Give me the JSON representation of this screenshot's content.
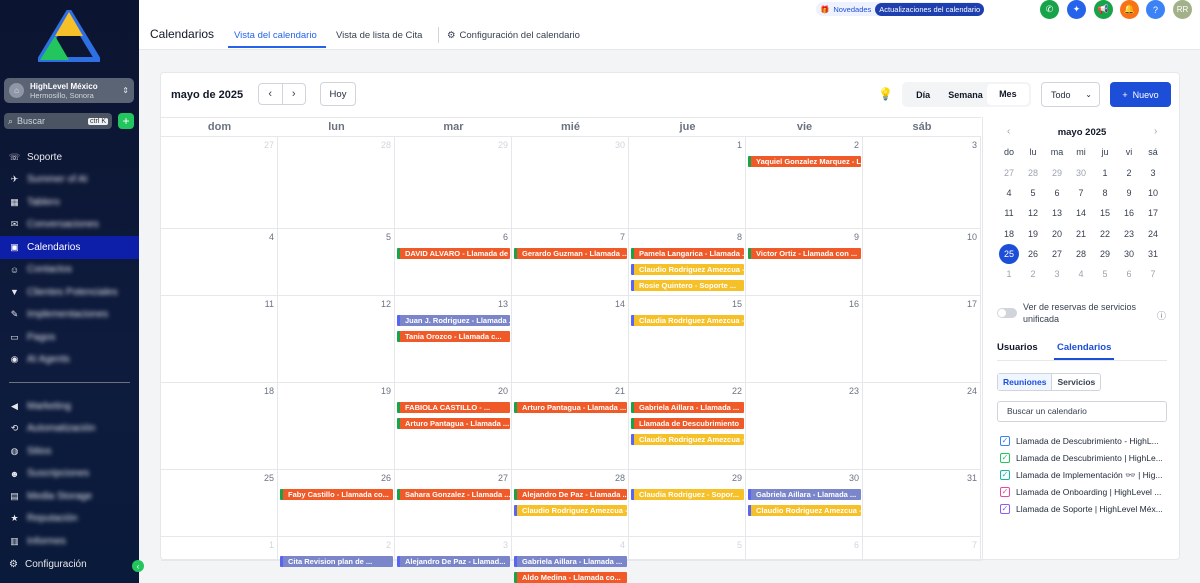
{
  "sidebar": {
    "account_name": "HighLevel México",
    "account_location": "Hermosillo, Sonora",
    "search_placeholder": "Buscar",
    "search_shortcut": "ctrl K",
    "items": [
      {
        "label": "Soporte",
        "icon": "phone-icon",
        "blur": false,
        "active": false
      },
      {
        "label": "Summer of AI",
        "icon": "rocket-icon",
        "blur": true,
        "active": false
      },
      {
        "label": "Tablero",
        "icon": "dashboard-icon",
        "blur": true,
        "active": false
      },
      {
        "label": "Conversaciones",
        "icon": "chat-icon",
        "blur": true,
        "active": false
      },
      {
        "label": "Calendarios",
        "icon": "calendar-icon",
        "blur": false,
        "active": true
      },
      {
        "label": "Contactos",
        "icon": "contacts-icon",
        "blur": true,
        "active": false
      },
      {
        "label": "Clientes Potenciales",
        "icon": "funnel-icon",
        "blur": true,
        "active": false
      },
      {
        "label": "Implementaciones",
        "icon": "tools-icon",
        "blur": true,
        "active": false
      },
      {
        "label": "Pagos",
        "icon": "card-icon",
        "blur": true,
        "active": false
      },
      {
        "label": "AI Agents",
        "icon": "robot-icon",
        "blur": true,
        "active": false
      },
      {
        "label": "Marketing",
        "icon": "megaphone-icon",
        "blur": true,
        "active": false
      },
      {
        "label": "Automatización",
        "icon": "automation-icon",
        "blur": true,
        "active": false
      },
      {
        "label": "Sitios",
        "icon": "globe-icon",
        "blur": true,
        "active": false
      },
      {
        "label": "Suscripciones",
        "icon": "people-icon",
        "blur": true,
        "active": false
      },
      {
        "label": "Media Storage",
        "icon": "folder-icon",
        "blur": true,
        "active": false
      },
      {
        "label": "Reputación",
        "icon": "star-icon",
        "blur": true,
        "active": false
      },
      {
        "label": "Informes",
        "icon": "chart-icon",
        "blur": true,
        "active": false
      }
    ],
    "config_label": "Configuración"
  },
  "topbar": {
    "title": "Calendarios",
    "tabs": [
      "Vista del calendario",
      "Vista de lista de Cita",
      "Configuración del calendario"
    ],
    "novedades": "Novedades",
    "updates_pill": "Actualizaciones del calendario",
    "avatar_initials": "RR",
    "icons": [
      {
        "name": "phone-icon",
        "color": "#16a34a"
      },
      {
        "name": "magic-icon",
        "color": "#2563eb"
      },
      {
        "name": "megaphone-icon",
        "color": "#16a34a"
      },
      {
        "name": "bell-icon",
        "color": "#f97316"
      },
      {
        "name": "help-icon",
        "color": "#3b82f6"
      }
    ]
  },
  "toolbar": {
    "month_title": "mayo de 2025",
    "today": "Hoy",
    "views": [
      "Día",
      "Semana",
      "Mes"
    ],
    "selected_view": "Mes",
    "filter": "Todo",
    "new_button": "Nuevo"
  },
  "calendar": {
    "dow": [
      "dom",
      "lun",
      "mar",
      "mié",
      "jue",
      "vie",
      "sáb"
    ],
    "weeks": [
      [
        {
          "d": "27",
          "m": true
        },
        {
          "d": "28",
          "m": true
        },
        {
          "d": "29",
          "m": true
        },
        {
          "d": "30",
          "m": true
        },
        {
          "d": "1",
          "m": false
        },
        {
          "d": "2",
          "m": false
        },
        {
          "d": "3",
          "m": false
        }
      ],
      [
        {
          "d": "4",
          "m": false
        },
        {
          "d": "5",
          "m": false
        },
        {
          "d": "6",
          "m": false
        },
        {
          "d": "7",
          "m": false
        },
        {
          "d": "8",
          "m": false
        },
        {
          "d": "9",
          "m": false
        },
        {
          "d": "10",
          "m": false
        }
      ],
      [
        {
          "d": "11",
          "m": false
        },
        {
          "d": "12",
          "m": false
        },
        {
          "d": "13",
          "m": false
        },
        {
          "d": "14",
          "m": false
        },
        {
          "d": "15",
          "m": false
        },
        {
          "d": "16",
          "m": false
        },
        {
          "d": "17",
          "m": false
        }
      ],
      [
        {
          "d": "18",
          "m": false
        },
        {
          "d": "19",
          "m": false
        },
        {
          "d": "20",
          "m": false
        },
        {
          "d": "21",
          "m": false
        },
        {
          "d": "22",
          "m": false
        },
        {
          "d": "23",
          "m": false
        },
        {
          "d": "24",
          "m": false
        }
      ],
      [
        {
          "d": "25",
          "m": false
        },
        {
          "d": "26",
          "m": false
        },
        {
          "d": "27",
          "m": false
        },
        {
          "d": "28",
          "m": false
        },
        {
          "d": "29",
          "m": false
        },
        {
          "d": "30",
          "m": false
        },
        {
          "d": "31",
          "m": false
        }
      ],
      [
        {
          "d": "1",
          "m": true
        },
        {
          "d": "2",
          "m": true
        },
        {
          "d": "3",
          "m": true
        },
        {
          "d": "4",
          "m": true
        },
        {
          "d": "5",
          "m": true
        },
        {
          "d": "6",
          "m": true
        },
        {
          "d": "7",
          "m": true
        }
      ]
    ],
    "events": [
      {
        "week": 0,
        "day": 5,
        "slot": 0,
        "color": "orange",
        "border": "green",
        "text": "Yaquiel Gonzalez Marquez - Llamada de ..."
      },
      {
        "week": 1,
        "day": 2,
        "slot": 0,
        "color": "orange",
        "border": "green",
        "text": "DAVID ALVARO - Llamada de ..."
      },
      {
        "week": 1,
        "day": 3,
        "slot": 0,
        "color": "orange",
        "border": "green",
        "text": "Gerardo Guzman - Llamada ..."
      },
      {
        "week": 1,
        "day": 4,
        "slot": 0,
        "color": "orange",
        "border": "green",
        "text": "Pamela Langarica - Llamada ..."
      },
      {
        "week": 1,
        "day": 4,
        "slot": 1,
        "color": "yellow",
        "border": "blue",
        "text": "Claudio Rodriguez Amezcua - ..."
      },
      {
        "week": 1,
        "day": 4,
        "slot": 2,
        "color": "yellow",
        "border": "blue",
        "text": "Rosie Quintero - Soporte ..."
      },
      {
        "week": 1,
        "day": 5,
        "slot": 0,
        "color": "orange",
        "border": "green",
        "text": "Victor Ortiz - Llamada con ..."
      },
      {
        "week": 2,
        "day": 2,
        "slot": 0,
        "color": "blue",
        "border": "blue",
        "text": "Juan J. Rodriguez - Llamada ..."
      },
      {
        "week": 2,
        "day": 2,
        "slot": 1,
        "color": "orange",
        "border": "green",
        "text": "Tania Orozco - Llamada c..."
      },
      {
        "week": 2,
        "day": 4,
        "slot": 0,
        "color": "yellow",
        "border": "blue",
        "text": "Claudia Rodriguez Amezcua - ..."
      },
      {
        "week": 3,
        "day": 2,
        "slot": 0,
        "color": "orange",
        "border": "green",
        "text": "FABIOLA CASTILLO - ..."
      },
      {
        "week": 3,
        "day": 2,
        "slot": 1,
        "color": "orange",
        "border": "green",
        "text": "Arturo Pantagua - Llamada ..."
      },
      {
        "week": 3,
        "day": 3,
        "slot": 0,
        "color": "orange",
        "border": "green",
        "text": "Arturo Pantagua - Llamada ..."
      },
      {
        "week": 3,
        "day": 4,
        "slot": 0,
        "color": "orange",
        "border": "green",
        "text": "Gabriela Aillara - Llamada ..."
      },
      {
        "week": 3,
        "day": 4,
        "slot": 1,
        "color": "orange",
        "border": "green",
        "text": "Llamada de Descubrimiento"
      },
      {
        "week": 3,
        "day": 4,
        "slot": 2,
        "color": "yellow",
        "border": "blue",
        "text": "Claudio Rodriguez Amezcua - ..."
      },
      {
        "week": 4,
        "day": 1,
        "slot": 0,
        "color": "orange",
        "border": "green",
        "text": "Faby Castillo - Llamada co..."
      },
      {
        "week": 4,
        "day": 2,
        "slot": 0,
        "color": "orange",
        "border": "green",
        "text": "Sahara Gonzalez - Llamada ..."
      },
      {
        "week": 4,
        "day": 3,
        "slot": 0,
        "color": "orange",
        "border": "green",
        "text": "Alejandro De Paz - Llamada ..."
      },
      {
        "week": 4,
        "day": 3,
        "slot": 1,
        "color": "yellow",
        "border": "blue",
        "text": "Claudio Rodriguez Amezcua - ..."
      },
      {
        "week": 4,
        "day": 4,
        "slot": 0,
        "color": "yellow",
        "border": "blue",
        "text": "Claudia Rodriguez - Sopor..."
      },
      {
        "week": 4,
        "day": 5,
        "slot": 0,
        "color": "blue",
        "border": "blue",
        "text": "Gabriela Aillara - Llamada ..."
      },
      {
        "week": 4,
        "day": 5,
        "slot": 1,
        "color": "yellow",
        "border": "blue",
        "text": "Claudio Rodriguez Amezcua - ..."
      },
      {
        "week": 5,
        "day": 1,
        "slot": 0,
        "color": "blue",
        "border": "blue",
        "text": "Cita Revision plan de ..."
      },
      {
        "week": 5,
        "day": 2,
        "slot": 0,
        "color": "blue",
        "border": "blue",
        "text": "Alejandro De Paz - Llamad..."
      },
      {
        "week": 5,
        "day": 3,
        "slot": 0,
        "color": "blue",
        "border": "blue",
        "text": "Gabriela Aillara - Llamada ..."
      },
      {
        "week": 5,
        "day": 3,
        "slot": 1,
        "color": "orange",
        "border": "green",
        "text": "Aldo Medina - Llamada co..."
      }
    ]
  },
  "mini": {
    "title": "mayo 2025",
    "dow": [
      "do",
      "lu",
      "ma",
      "mi",
      "ju",
      "vi",
      "sá"
    ],
    "weeks": [
      [
        {
          "d": "27",
          "m": true
        },
        {
          "d": "28",
          "m": true
        },
        {
          "d": "29",
          "m": true
        },
        {
          "d": "30",
          "m": true
        },
        {
          "d": "1",
          "m": false
        },
        {
          "d": "2",
          "m": false
        },
        {
          "d": "3",
          "m": false
        }
      ],
      [
        {
          "d": "4",
          "m": false
        },
        {
          "d": "5",
          "m": false
        },
        {
          "d": "6",
          "m": false
        },
        {
          "d": "7",
          "m": false
        },
        {
          "d": "8",
          "m": false
        },
        {
          "d": "9",
          "m": false
        },
        {
          "d": "10",
          "m": false
        }
      ],
      [
        {
          "d": "11",
          "m": false
        },
        {
          "d": "12",
          "m": false
        },
        {
          "d": "13",
          "m": false
        },
        {
          "d": "14",
          "m": false
        },
        {
          "d": "15",
          "m": false
        },
        {
          "d": "16",
          "m": false
        },
        {
          "d": "17",
          "m": false
        }
      ],
      [
        {
          "d": "18",
          "m": false
        },
        {
          "d": "19",
          "m": false
        },
        {
          "d": "20",
          "m": false
        },
        {
          "d": "21",
          "m": false
        },
        {
          "d": "22",
          "m": false
        },
        {
          "d": "23",
          "m": false
        },
        {
          "d": "24",
          "m": false
        }
      ],
      [
        {
          "d": "25",
          "m": false,
          "today": true
        },
        {
          "d": "26",
          "m": false
        },
        {
          "d": "27",
          "m": false
        },
        {
          "d": "28",
          "m": false
        },
        {
          "d": "29",
          "m": false
        },
        {
          "d": "30",
          "m": false
        },
        {
          "d": "31",
          "m": false
        }
      ],
      [
        {
          "d": "1",
          "m": true
        },
        {
          "d": "2",
          "m": true
        },
        {
          "d": "3",
          "m": true
        },
        {
          "d": "4",
          "m": true
        },
        {
          "d": "5",
          "m": true
        },
        {
          "d": "6",
          "m": true
        },
        {
          "d": "7",
          "m": true
        }
      ]
    ]
  },
  "panel": {
    "toggle_label": "Ver de reservas de servicios unificada",
    "tab_users": "Usuarios",
    "tab_calendars": "Calendarios",
    "seg_meetings": "Reuniones",
    "seg_services": "Servicios",
    "search_placeholder": "Buscar un calendario",
    "calendars": [
      {
        "label": "Llamada de Descubrimiento - HighL...",
        "color": "#3b82f6"
      },
      {
        "label": "Llamada de Descubrimiento | HighLe...",
        "color": "#22c55e"
      },
      {
        "label": "Llamada de Implementación 👓 | Hig...",
        "color": "#14b8a6"
      },
      {
        "label": "Llamada de Onboarding | HighLevel ...",
        "color": "#ec4899"
      },
      {
        "label": "Llamada de Soporte | HighLevel Méx...",
        "color": "#8b5cf6"
      }
    ]
  }
}
